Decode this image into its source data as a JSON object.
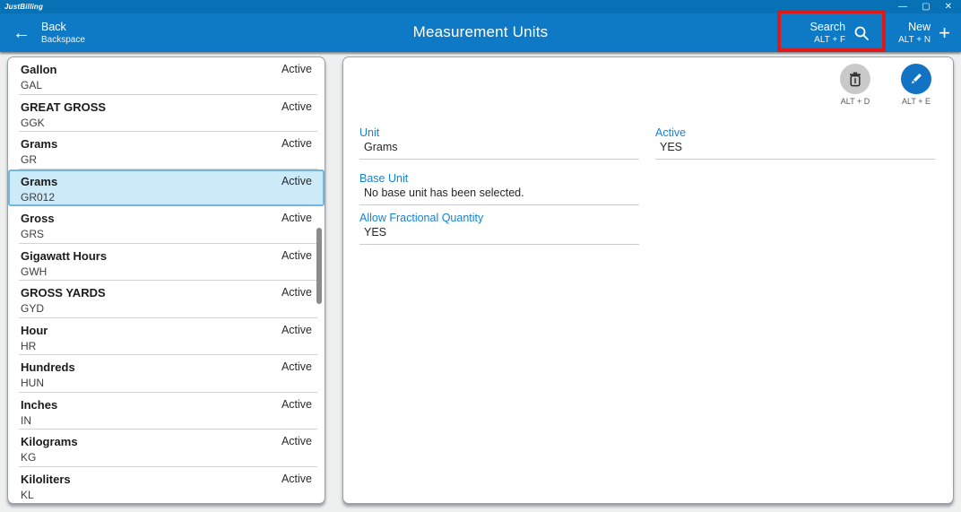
{
  "app": {
    "logo_text": "JustBilling"
  },
  "window_controls": {
    "minimize": "—",
    "maximize": "▢",
    "close": "✕"
  },
  "header": {
    "back": {
      "label": "Back",
      "shortcut": "Backspace",
      "icon": "←"
    },
    "title": "Measurement Units",
    "search": {
      "label": "Search",
      "shortcut": "ALT + F"
    },
    "new": {
      "label": "New",
      "shortcut": "ALT + N",
      "icon": "+"
    }
  },
  "list": {
    "items": [
      {
        "name": "Gallon",
        "code": "GAL",
        "status": "Active",
        "selected": false
      },
      {
        "name": "GREAT GROSS",
        "code": "GGK",
        "status": "Active",
        "selected": false
      },
      {
        "name": "Grams",
        "code": "GR",
        "status": "Active",
        "selected": false
      },
      {
        "name": "Grams",
        "code": "GR012",
        "status": "Active",
        "selected": true
      },
      {
        "name": "Gross",
        "code": "GRS",
        "status": "Active",
        "selected": false
      },
      {
        "name": "Gigawatt Hours",
        "code": "GWH",
        "status": "Active",
        "selected": false
      },
      {
        "name": "GROSS YARDS",
        "code": "GYD",
        "status": "Active",
        "selected": false
      },
      {
        "name": "Hour",
        "code": "HR",
        "status": "Active",
        "selected": false
      },
      {
        "name": "Hundreds",
        "code": "HUN",
        "status": "Active",
        "selected": false
      },
      {
        "name": "Inches",
        "code": "IN",
        "status": "Active",
        "selected": false
      },
      {
        "name": "Kilograms",
        "code": "KG",
        "status": "Active",
        "selected": false
      },
      {
        "name": "Kiloliters",
        "code": "KL",
        "status": "Active",
        "selected": false
      }
    ]
  },
  "detail": {
    "delete_shortcut": "ALT + D",
    "edit_shortcut": "ALT + E",
    "unit": {
      "label": "Unit",
      "value": "Grams"
    },
    "active": {
      "label": "Active",
      "value": "YES"
    },
    "base_unit": {
      "label": "Base Unit",
      "value": "No base unit has been selected."
    },
    "allow_fractional": {
      "label": "Allow Fractional Quantity",
      "value": "YES"
    }
  },
  "colors": {
    "titlebar": "#0671b5",
    "header": "#0e7ac6",
    "accent_blue": "#1583d5",
    "selection_bg": "#cdeaf9",
    "selection_border": "#70b7e5",
    "edit_button": "#1173c2",
    "delete_button": "#c9c9c9",
    "annotation_red": "#dd1a1a"
  }
}
